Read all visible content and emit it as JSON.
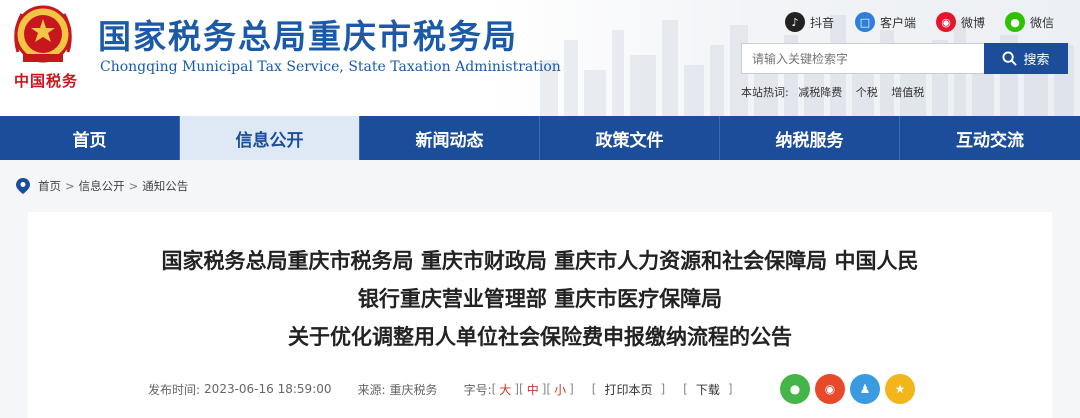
{
  "header": {
    "logo_text": "中国税务",
    "title": "国家税务总局重庆市税务局",
    "subtitle": "Chongqing Municipal Tax Service, State Taxation Administration"
  },
  "social": [
    {
      "label": "抖音",
      "icon": "douyin-icon",
      "color": "#222222",
      "glyph": "♪"
    },
    {
      "label": "客户端",
      "icon": "app-client-icon",
      "color": "#2f7fd8",
      "glyph": "□"
    },
    {
      "label": "微博",
      "icon": "weibo-icon",
      "color": "#e6162d",
      "glyph": "◉"
    },
    {
      "label": "微信",
      "icon": "wechat-icon",
      "color": "#2dc100",
      "glyph": "●"
    }
  ],
  "search": {
    "placeholder": "请输入关键检索字",
    "button_label": "搜索",
    "hot_label": "本站热词:",
    "hot_words": [
      "减税降费",
      "个税",
      "增值税"
    ]
  },
  "nav": {
    "items": [
      "首页",
      "信息公开",
      "新闻动态",
      "政策文件",
      "纳税服务",
      "互动交流"
    ],
    "active_index": 1
  },
  "breadcrumb": {
    "items": [
      "首页",
      "信息公开",
      "通知公告"
    ],
    "separator": ">"
  },
  "article": {
    "title_lines": [
      "国家税务总局重庆市税务局 重庆市财政局 重庆市人力资源和社会保障局 中国人民",
      "银行重庆营业管理部 重庆市医疗保障局",
      "关于优化调整用人单位社会保险费申报缴纳流程的公告"
    ],
    "publish_label": "发布时间:",
    "publish_time": "2023-06-16 18:59:00",
    "source_label": "来源:",
    "source": "重庆税务",
    "font_label": "字号:",
    "font_sizes": [
      "大",
      "中",
      "小"
    ],
    "print_label": "打印本页",
    "download_label": "下载"
  },
  "share": [
    {
      "icon": "wechat-share-icon",
      "color": "#44b549",
      "glyph": "●"
    },
    {
      "icon": "weibo-share-icon",
      "color": "#e8492b",
      "glyph": "◉"
    },
    {
      "icon": "qq-share-icon",
      "color": "#3a9be0",
      "glyph": "♟"
    },
    {
      "icon": "qzone-share-icon",
      "color": "#f2b51b",
      "glyph": "★"
    }
  ]
}
